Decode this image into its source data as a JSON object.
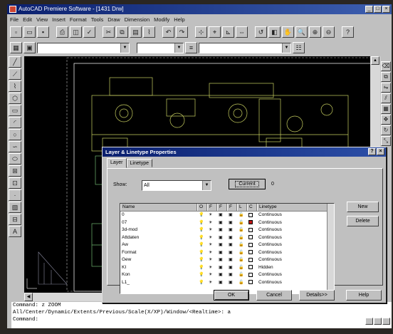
{
  "window": {
    "title": "AutoCAD Premiere Software - [1431 Drw]"
  },
  "menu": [
    "File",
    "Edit",
    "View",
    "Insert",
    "Format",
    "Tools",
    "Draw",
    "Dimension",
    "Modify",
    "Help"
  ],
  "command_lines": [
    "Command: z ZOOM",
    "All/Center/Dynamic/Extents/Previous/Scale(X/XP)/Window/<Realtime>: a",
    "Command:"
  ],
  "dialog": {
    "title": "Layer & Linetype Properties",
    "tabs": [
      "Layer",
      "Linetype"
    ],
    "show_label": "Show:",
    "show_value": "All",
    "current_button": "Current",
    "current_value": "0",
    "columns": [
      "Name",
      "O",
      "F",
      "F",
      "F",
      "L",
      "C",
      "Linetype"
    ],
    "layers": [
      {
        "name": "0",
        "color": "#ffffff",
        "linetype": "Continuous"
      },
      {
        "name": "07",
        "color": "#c01818",
        "linetype": "Continuous"
      },
      {
        "name": "3d-mod",
        "color": "#ffffff",
        "linetype": "Continuous"
      },
      {
        "name": "Attdaten",
        "color": "#ffffff",
        "linetype": "Continuous"
      },
      {
        "name": "Aw",
        "color": "#ffffff",
        "linetype": "Continuous"
      },
      {
        "name": "Format",
        "color": "#ffffff",
        "linetype": "Continuous"
      },
      {
        "name": "Gew",
        "color": "#ffffff",
        "linetype": "Continuous"
      },
      {
        "name": "KI",
        "color": "#ffffff",
        "linetype": "Hidden"
      },
      {
        "name": "Kon",
        "color": "#ffffff",
        "linetype": "Continuous"
      },
      {
        "name": "L1_",
        "color": "#ffffff",
        "linetype": "Continuous"
      }
    ],
    "buttons": {
      "new": "New",
      "delete": "Delete",
      "ok": "OK",
      "cancel": "Cancel",
      "details": "Details>>",
      "help": "Help"
    }
  }
}
